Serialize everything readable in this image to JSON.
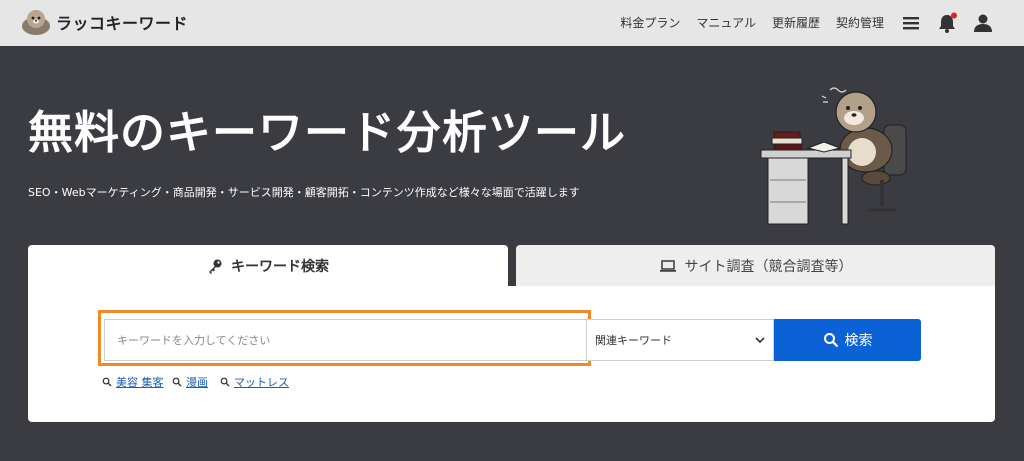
{
  "header": {
    "logo_text": "ラッコキーワード",
    "nav": [
      "料金プラン",
      "マニュアル",
      "更新履歴",
      "契約管理"
    ],
    "icons": [
      "menu-icon",
      "bell-icon",
      "user-icon"
    ],
    "notification_color": "#e0202a"
  },
  "hero": {
    "title": "無料のキーワード分析ツール",
    "subtitle": "SEO・Webマーケティング・商品開発・サービス開発・顧客開拓・コンテンツ作成など様々な場面で活躍します"
  },
  "tabs": [
    {
      "label": "キーワード検索",
      "icon": "key-icon",
      "active": true
    },
    {
      "label": "サイト調査（競合調査等）",
      "icon": "laptop-icon",
      "active": false
    }
  ],
  "search": {
    "placeholder": "キーワードを入力してください",
    "value": "",
    "mode_selected": "関連キーワード",
    "button_label": "検索"
  },
  "suggestions": [
    "美容 集客",
    "漫画",
    "マットレス"
  ],
  "colors": {
    "background": "#3b3b42",
    "header": "#e6e6e6",
    "primary": "#0b62d6",
    "highlight": "#f08a24",
    "link": "#1a5fb4"
  }
}
